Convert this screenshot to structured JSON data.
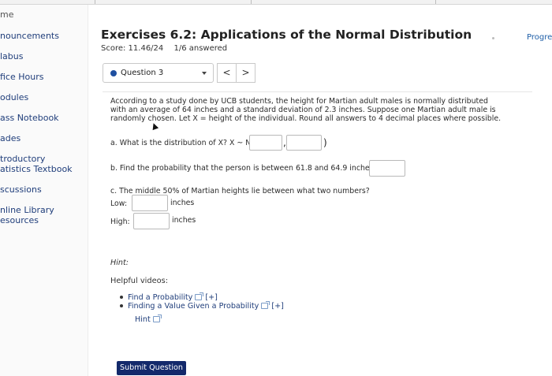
{
  "sidebar": {
    "items": [
      {
        "label": "me"
      },
      {
        "label": "nouncements"
      },
      {
        "label": "labus"
      },
      {
        "label": "fice Hours"
      },
      {
        "label": "odules"
      },
      {
        "label": "ass Notebook"
      },
      {
        "label": "ades"
      },
      {
        "label": "troductory"
      },
      {
        "label": "atistics Textbook"
      },
      {
        "label": "scussions"
      },
      {
        "label": "nline Library"
      },
      {
        "label": "esources"
      }
    ]
  },
  "header": {
    "title": "Exercises 6.2: Applications of the Normal Distribution",
    "score": "Score: 11.46/24",
    "answered": "1/6 answered",
    "progress_link": "Progre"
  },
  "question_nav": {
    "selected": "Question 3",
    "prev": "<",
    "next": ">"
  },
  "question": {
    "intro": "According to a study done by UCB students, the height for Martian adult males is normally distributed with an average of 64 inches and a standard deviation of 2.3 inches. Suppose one Martian adult male is randomly chosen. Let X = height of the individual. Round all answers to 4 decimal places where possible.",
    "part_a": "a. What is the distribution of X? X ~ N(",
    "part_a_close": ")",
    "part_a_comma": ",",
    "part_b": "b. Find the probability that the person is between 61.8 and 64.9 inches.",
    "part_c": "c. The middle 50% of Martian heights lie between what two numbers?",
    "low_label": "Low:",
    "high_label": "High:",
    "units": "inches"
  },
  "help": {
    "hint_heading": "Hint:",
    "helpful_heading": "Helpful videos:",
    "videos": [
      {
        "label": "Find a Probability",
        "expand": "[+]"
      },
      {
        "label": "Finding a Value Given a Probability",
        "expand": "[+]"
      }
    ],
    "hint_link": "Hint"
  },
  "actions": {
    "submit_label": "Submit Question"
  }
}
